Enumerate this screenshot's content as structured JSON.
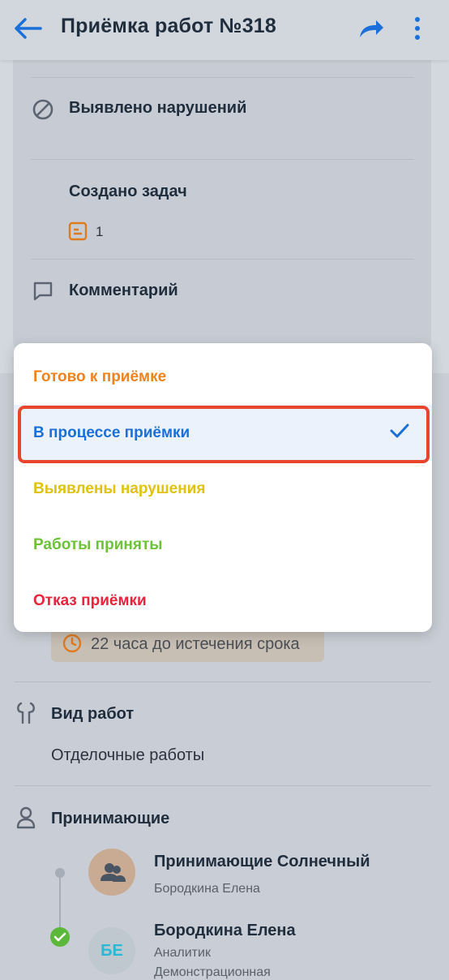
{
  "header": {
    "title": "Приёмка работ №318",
    "back_icon": "arrow-left-icon",
    "share_icon": "share-icon",
    "more_icon": "more-vertical-icon"
  },
  "card": {
    "violations_label": "Выявлено нарушений",
    "tasks_label": "Создано задач",
    "tasks_count": "1",
    "comment_label": "Комментарий"
  },
  "menu": {
    "items": [
      {
        "label": "Готово к приёмке",
        "color": "#f0821e"
      },
      {
        "label": "В процессе приёмки",
        "color": "#1a6fd8",
        "selected": true
      },
      {
        "label": "Выявлены нарушения",
        "color": "#e0c20f"
      },
      {
        "label": "Работы приняты",
        "color": "#6cc33a"
      },
      {
        "label": "Отказ приёмки",
        "color": "#e8233a"
      }
    ]
  },
  "deadline": {
    "text": "22 часа до истечения срока"
  },
  "work_type": {
    "label": "Вид работ",
    "value": "Отделочные работы"
  },
  "acceptors": {
    "label": "Принимающие",
    "group": {
      "name": "Принимающие Солнечный",
      "sub": "Бородкина Елена"
    },
    "person": {
      "initials": "БЕ",
      "name": "Бородкина Елена",
      "role": "Аналитик",
      "org": "Демонстрационная"
    }
  },
  "colors": {
    "accent": "#1a6fd8",
    "highlight": "#e8452d",
    "success": "#5bb83a"
  }
}
